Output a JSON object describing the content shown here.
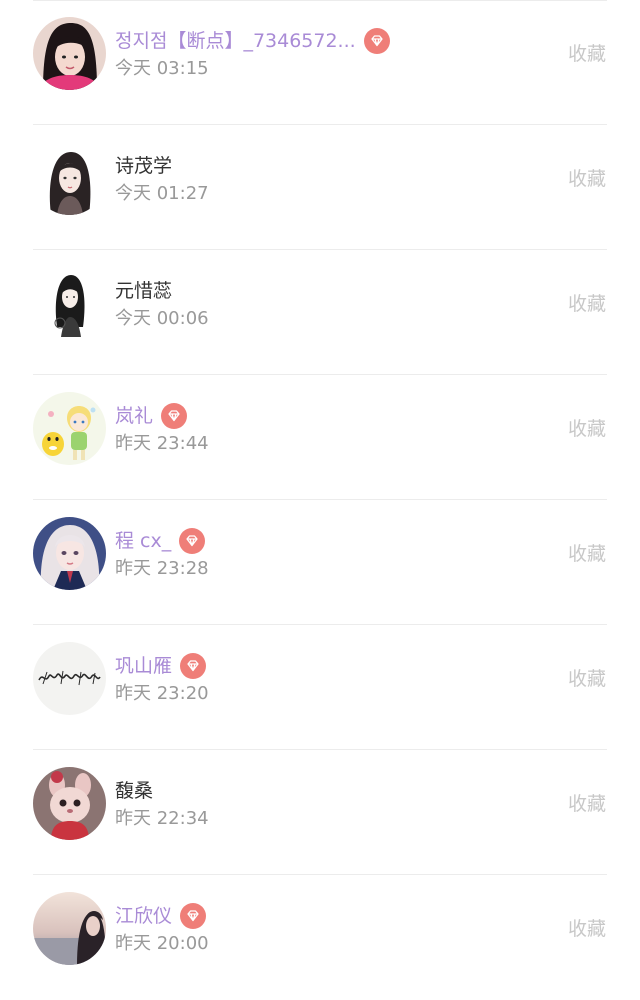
{
  "colors": {
    "vip_name": "#a98bd6",
    "normal_name": "#333333",
    "time": "#999999",
    "favorite": "#c8c8c8",
    "vip_badge": "#ef7e78",
    "divider": "#ececec"
  },
  "users": [
    {
      "name": "정지점【断点】_7346572...",
      "time": "今天 03:15",
      "vip": true,
      "action": "收藏",
      "avatar_icon": "user-avatar-icon"
    },
    {
      "name": "诗茂学",
      "time": "今天 01:27",
      "vip": false,
      "action": "收藏",
      "avatar_icon": "user-avatar-icon"
    },
    {
      "name": "元惜蕊",
      "time": "今天 00:06",
      "vip": false,
      "action": "收藏",
      "avatar_icon": "user-avatar-icon"
    },
    {
      "name": "岚礼",
      "time": "昨天 23:44",
      "vip": true,
      "action": "收藏",
      "avatar_icon": "user-avatar-icon"
    },
    {
      "name": "程 cx_",
      "time": "昨天 23:28",
      "vip": true,
      "action": "收藏",
      "avatar_icon": "user-avatar-icon"
    },
    {
      "name": "巩山雁",
      "time": "昨天 23:20",
      "vip": true,
      "action": "收藏",
      "avatar_icon": "user-avatar-icon"
    },
    {
      "name": "馥桑",
      "time": "昨天 22:34",
      "vip": false,
      "action": "收藏",
      "avatar_icon": "user-avatar-icon"
    },
    {
      "name": "江欣仪",
      "time": "昨天 20:00",
      "vip": true,
      "action": "收藏",
      "avatar_icon": "user-avatar-icon"
    }
  ]
}
